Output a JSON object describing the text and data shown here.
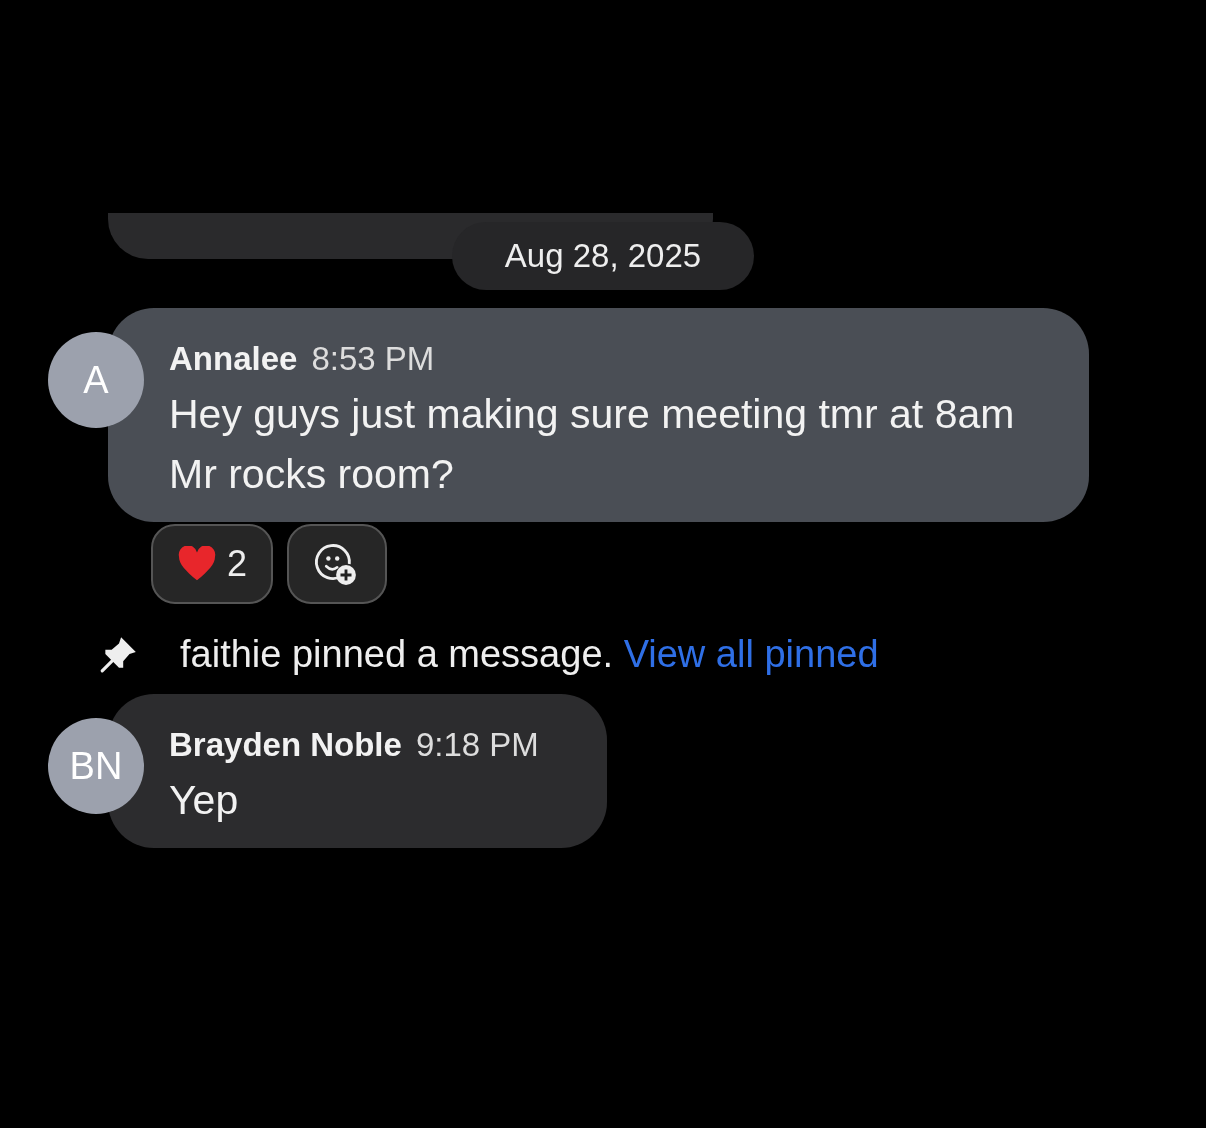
{
  "date_separator": "Aug 28, 2025",
  "messages": [
    {
      "avatar": "A",
      "author": "Annalee",
      "time": "8:53 PM",
      "text": "Hey guys just making sure meeting tmr at 8am Mr rocks room?",
      "highlighted": true,
      "reactions": [
        {
          "kind": "heart",
          "count": "2"
        }
      ]
    },
    {
      "kind": "pin_notice",
      "text": "faithie pinned a message.",
      "link": "View all pinned"
    },
    {
      "avatar": "BN",
      "author": "Brayden Noble",
      "time": "9:18 PM",
      "text": "Yep",
      "highlighted": false
    }
  ]
}
